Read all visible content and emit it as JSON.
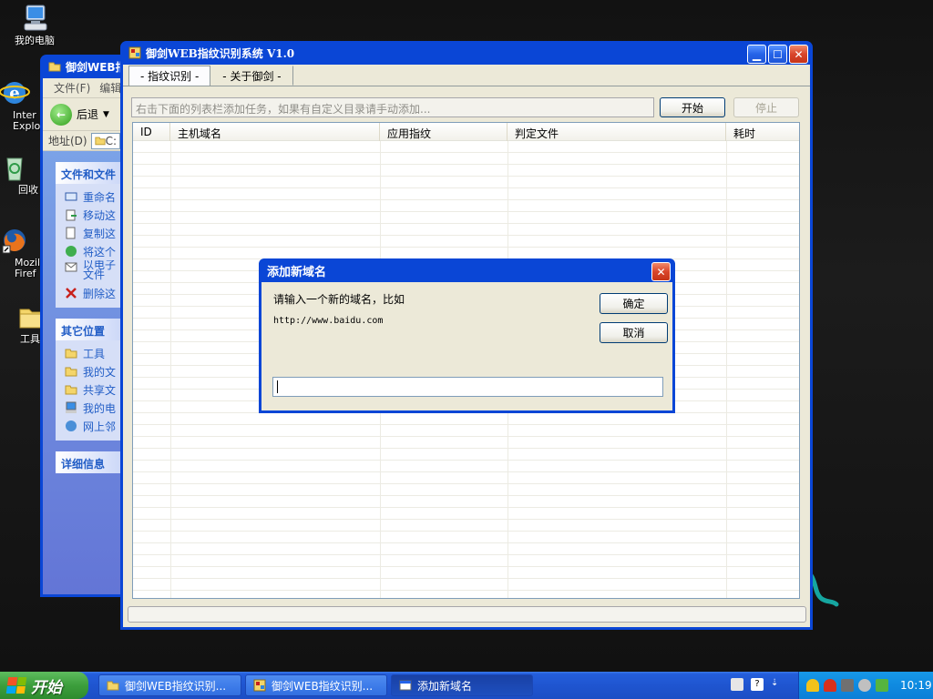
{
  "desktop": {
    "icons": [
      {
        "label": "我的电脑"
      },
      {
        "label": "Inter\nExplo"
      },
      {
        "label": "回收"
      },
      {
        "label": "Mozil\nFiref"
      },
      {
        "label": "工具"
      }
    ]
  },
  "explorer": {
    "title": "御剑WEB指",
    "menu": [
      "文件(F)",
      "编辑"
    ],
    "back_label": "后退",
    "address_label": "地址(D)",
    "address_value": "C:",
    "panels": [
      {
        "header": "文件和文件",
        "items": [
          "重命名",
          "移动这",
          "复制这",
          "将这个",
          "以电子\n文件",
          "删除这"
        ]
      },
      {
        "header": "其它位置",
        "items": [
          "工具",
          "我的文",
          "共享文",
          "我的电",
          "网上邻"
        ]
      },
      {
        "header": "详细信息",
        "items": []
      }
    ]
  },
  "main_window": {
    "title": "御剑WEB指纹识别系统 V1.0",
    "tabs": [
      "- 指纹识别 -",
      "- 关于御剑 -"
    ],
    "hint_text": "右击下面的列表栏添加任务，如果有自定义目录请手动添加...",
    "start_button": "开始",
    "stop_button": "停止",
    "columns": [
      "ID",
      "主机域名",
      "应用指纹",
      "判定文件",
      "耗时"
    ]
  },
  "dialog": {
    "title": "添加新域名",
    "prompt": "请输入一个新的域名，比如",
    "example": "http://www.baidu.com",
    "ok_button": "确定",
    "cancel_button": "取消",
    "input_value": ""
  },
  "taskbar": {
    "start_label": "开始",
    "tasks": [
      {
        "label": "御剑WEB指纹识别..."
      },
      {
        "label": "御剑WEB指纹识别..."
      },
      {
        "label": "添加新域名"
      }
    ],
    "clock": "10:19"
  },
  "colors": {
    "title_blue": "#0a46d6",
    "window_face": "#ece9d8",
    "start_green": "#3c9e3c",
    "tray_blue": "#0f8ae0"
  }
}
